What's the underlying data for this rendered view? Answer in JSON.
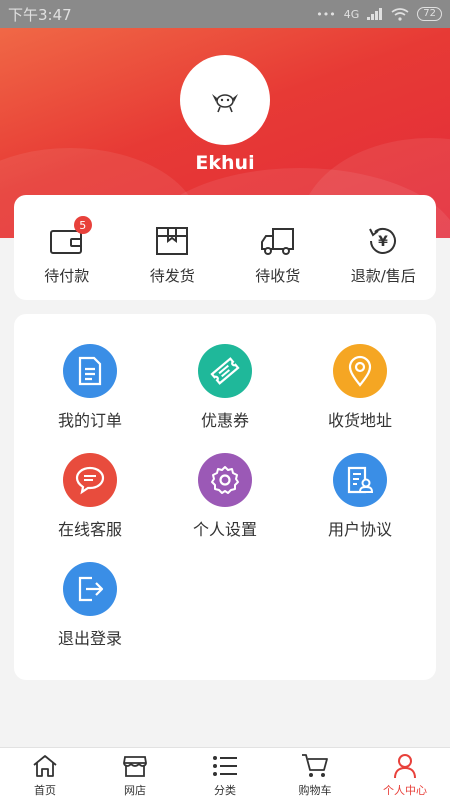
{
  "status_bar": {
    "time": "下午3:47",
    "network": "4G",
    "battery": "72"
  },
  "profile": {
    "username": "Ekhui"
  },
  "orders": [
    {
      "label": "待付款",
      "icon": "wallet-icon",
      "badge": "5"
    },
    {
      "label": "待发货",
      "icon": "package-box-icon"
    },
    {
      "label": "待收货",
      "icon": "delivery-truck-icon"
    },
    {
      "label": "退款/售后",
      "icon": "refund-yen-icon"
    }
  ],
  "menu": [
    {
      "label": "我的订单",
      "icon": "document-icon",
      "color": "#3a8ee6"
    },
    {
      "label": "优惠券",
      "icon": "ticket-icon",
      "color": "#1fb89a"
    },
    {
      "label": "收货地址",
      "icon": "location-pin-icon",
      "color": "#f5a623"
    },
    {
      "label": "在线客服",
      "icon": "chat-bubble-icon",
      "color": "#e84c3d"
    },
    {
      "label": "个人设置",
      "icon": "gear-icon",
      "color": "#9b59b6"
    },
    {
      "label": "用户协议",
      "icon": "agreement-icon",
      "color": "#3a8ee6"
    },
    {
      "label": "退出登录",
      "icon": "logout-icon",
      "color": "#3a8ee6"
    }
  ],
  "tabs": [
    {
      "label": "首页",
      "icon": "home-icon"
    },
    {
      "label": "网店",
      "icon": "store-icon"
    },
    {
      "label": "分类",
      "icon": "list-icon"
    },
    {
      "label": "购物车",
      "icon": "cart-icon"
    },
    {
      "label": "个人中心",
      "icon": "person-icon",
      "active": true
    }
  ],
  "colors": {
    "accent": "#e8413b",
    "header_start": "#f06846",
    "header_end": "#e32b3a"
  }
}
